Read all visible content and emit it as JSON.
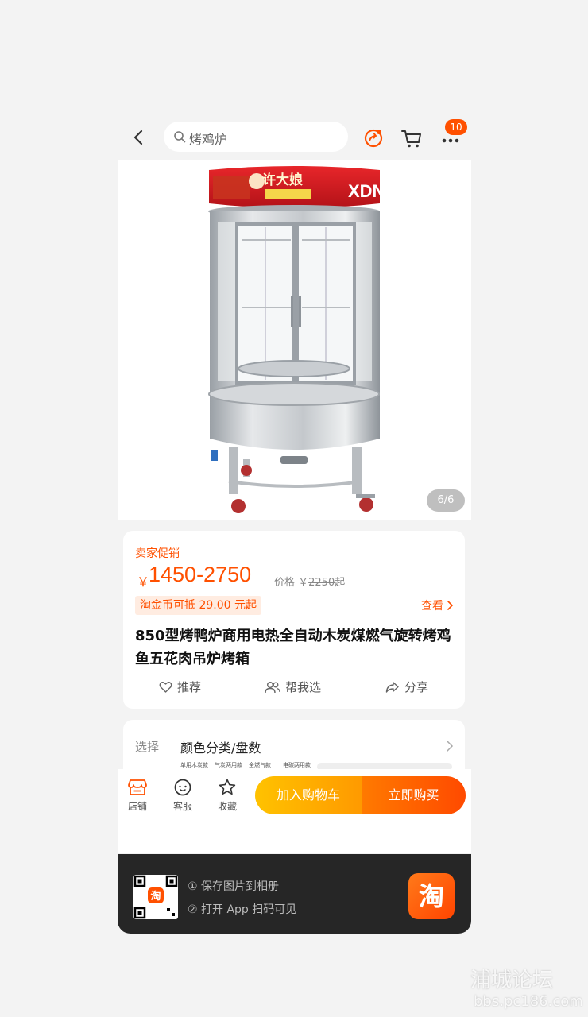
{
  "header": {
    "search_text": "烤鸡炉",
    "cart_badge": "10"
  },
  "gallery": {
    "counter": "6/6",
    "sign_brand": "许大娘",
    "sign_letters": "XDN"
  },
  "promo": {
    "label": "卖家促销",
    "currency": "￥",
    "price_range": "1450-2750",
    "price_prefix": "价格 ￥",
    "original_price": "2250",
    "price_suffix": "起",
    "coin_offer": "淘金币可抵 29.00 元起",
    "view_label": "查看"
  },
  "product": {
    "title": "850型烤鸭炉商用电热全自动木炭煤燃气旋转烤鸡鱼五花肉吊炉烤箱"
  },
  "actions": {
    "recommend": "推荐",
    "help_choose": "帮我选",
    "share": "分享"
  },
  "selection": {
    "label": "选择",
    "value": "颜色分类/盘数",
    "thumbs": [
      "单用木炭款",
      "气炭两用款",
      "全燃气款",
      "电碳两用款"
    ]
  },
  "bottom_bar": {
    "store": "店铺",
    "service": "客服",
    "favorite": "收藏",
    "add_to_cart": "加入购物车",
    "buy_now": "立即购买"
  },
  "footer": {
    "step1": "① 保存图片到相册",
    "step2": "② 打开 App 扫码可见",
    "logo_char": "淘",
    "qr_logo_char": "淘"
  },
  "watermark": {
    "text": "浦城论坛",
    "url": "bbs.pc186.com"
  },
  "colors": {
    "accent": "#ff5000",
    "cart_button": "#ffb300",
    "buy_button": "#ff5a00",
    "footer_bg": "#262626"
  }
}
